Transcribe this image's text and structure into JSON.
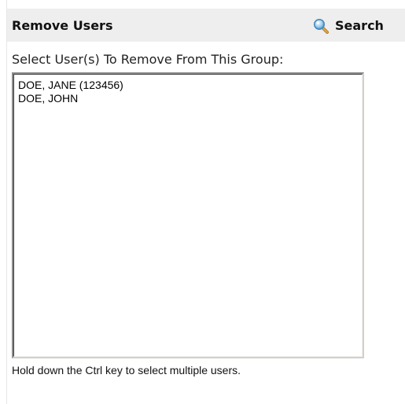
{
  "header": {
    "title": "Remove Users",
    "search_label": "Search",
    "search_icon": "magnifier-icon"
  },
  "form": {
    "prompt": "Select User(s) To Remove From This Group:",
    "users": [
      "DOE, JANE (123456)",
      "DOE, JOHN"
    ],
    "hint": "Hold down the Ctrl key to select multiple users."
  },
  "colors": {
    "header_background": "#eeeeee",
    "text": "#111111"
  }
}
